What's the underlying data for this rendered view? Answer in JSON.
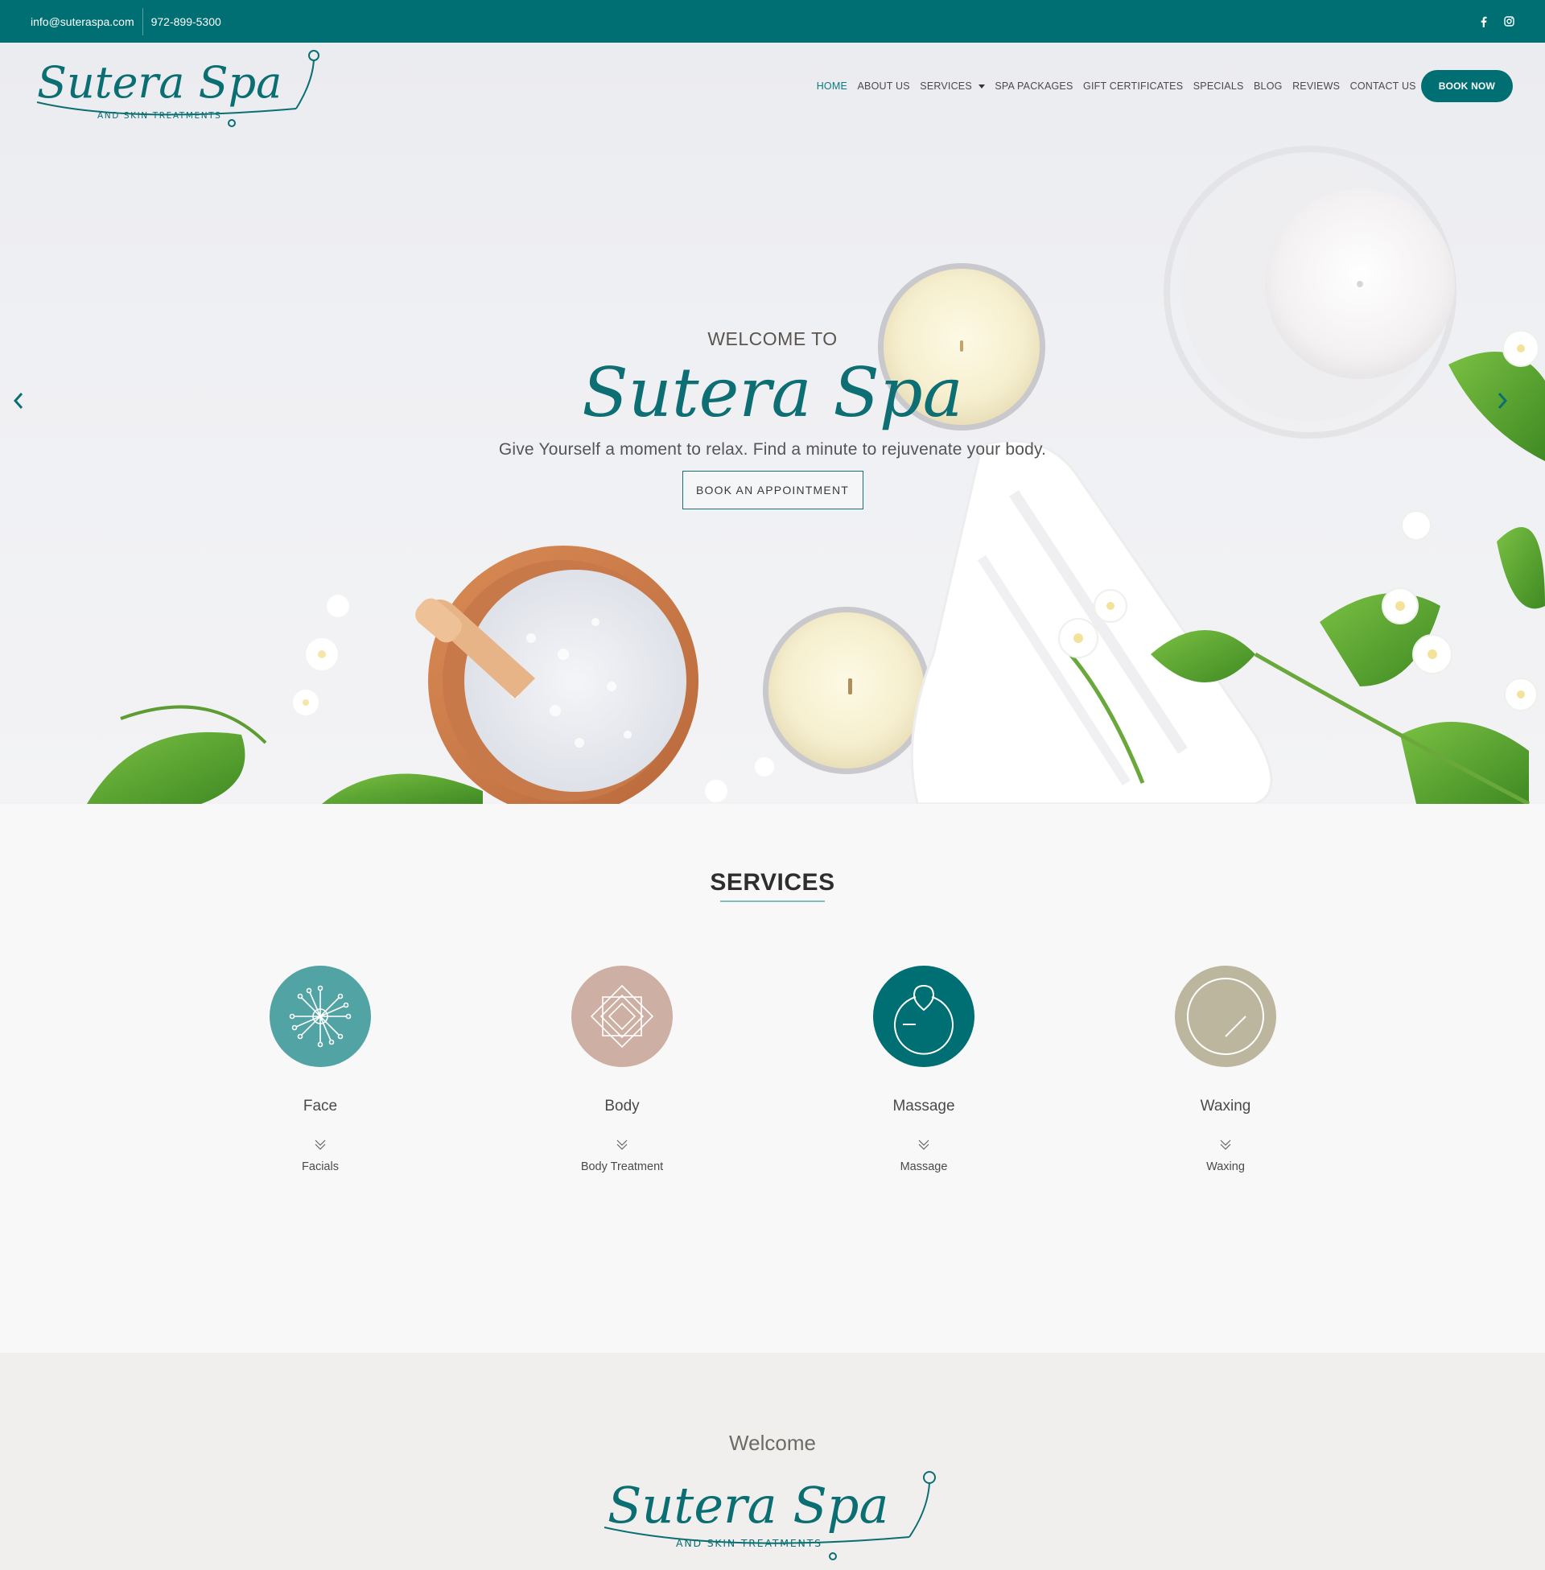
{
  "topbar": {
    "email": "info@suteraspa.com",
    "phone": "972-899-5300",
    "social": [
      "facebook-icon",
      "instagram-icon"
    ]
  },
  "logo": {
    "script": "Sutera Spa",
    "sub": "AND SKIN TREATMENTS"
  },
  "nav": {
    "items": [
      "HOME",
      "ABOUT US",
      "SERVICES",
      "SPA PACKAGES",
      "GIFT CERTIFICATES",
      "SPECIALS",
      "BLOG",
      "REVIEWS",
      "CONTACT US"
    ],
    "active": "HOME",
    "book": "BOOK NOW"
  },
  "hero": {
    "welcome": "WELCOME TO",
    "brand": "Sutera Spa",
    "tagline": "Give Yourself a moment to relax. Find a minute to rejuvenate your body.",
    "cta": "BOOK AN APPOINTMENT"
  },
  "services": {
    "heading": "SERVICES",
    "items": [
      {
        "title": "Face",
        "link": "Facials",
        "color": "#52a3a4",
        "icon": "dandelion-icon"
      },
      {
        "title": "Body",
        "link": "Body Treatment",
        "color": "#cdb0a3",
        "icon": "nested-diamond-icon"
      },
      {
        "title": "Massage",
        "link": "Massage",
        "color": "#006f73",
        "icon": "massage-stone-icon"
      },
      {
        "title": "Waxing",
        "link": "Waxing",
        "color": "#bdb69f",
        "icon": "waxing-circle-icon"
      }
    ]
  },
  "welcome": {
    "title": "Welcome",
    "logo_script": "Sutera Spa",
    "logo_sub": "AND SKIN TREATMENTS"
  },
  "colors": {
    "brand_teal": "#006f73",
    "light_teal": "#52a3a4"
  }
}
